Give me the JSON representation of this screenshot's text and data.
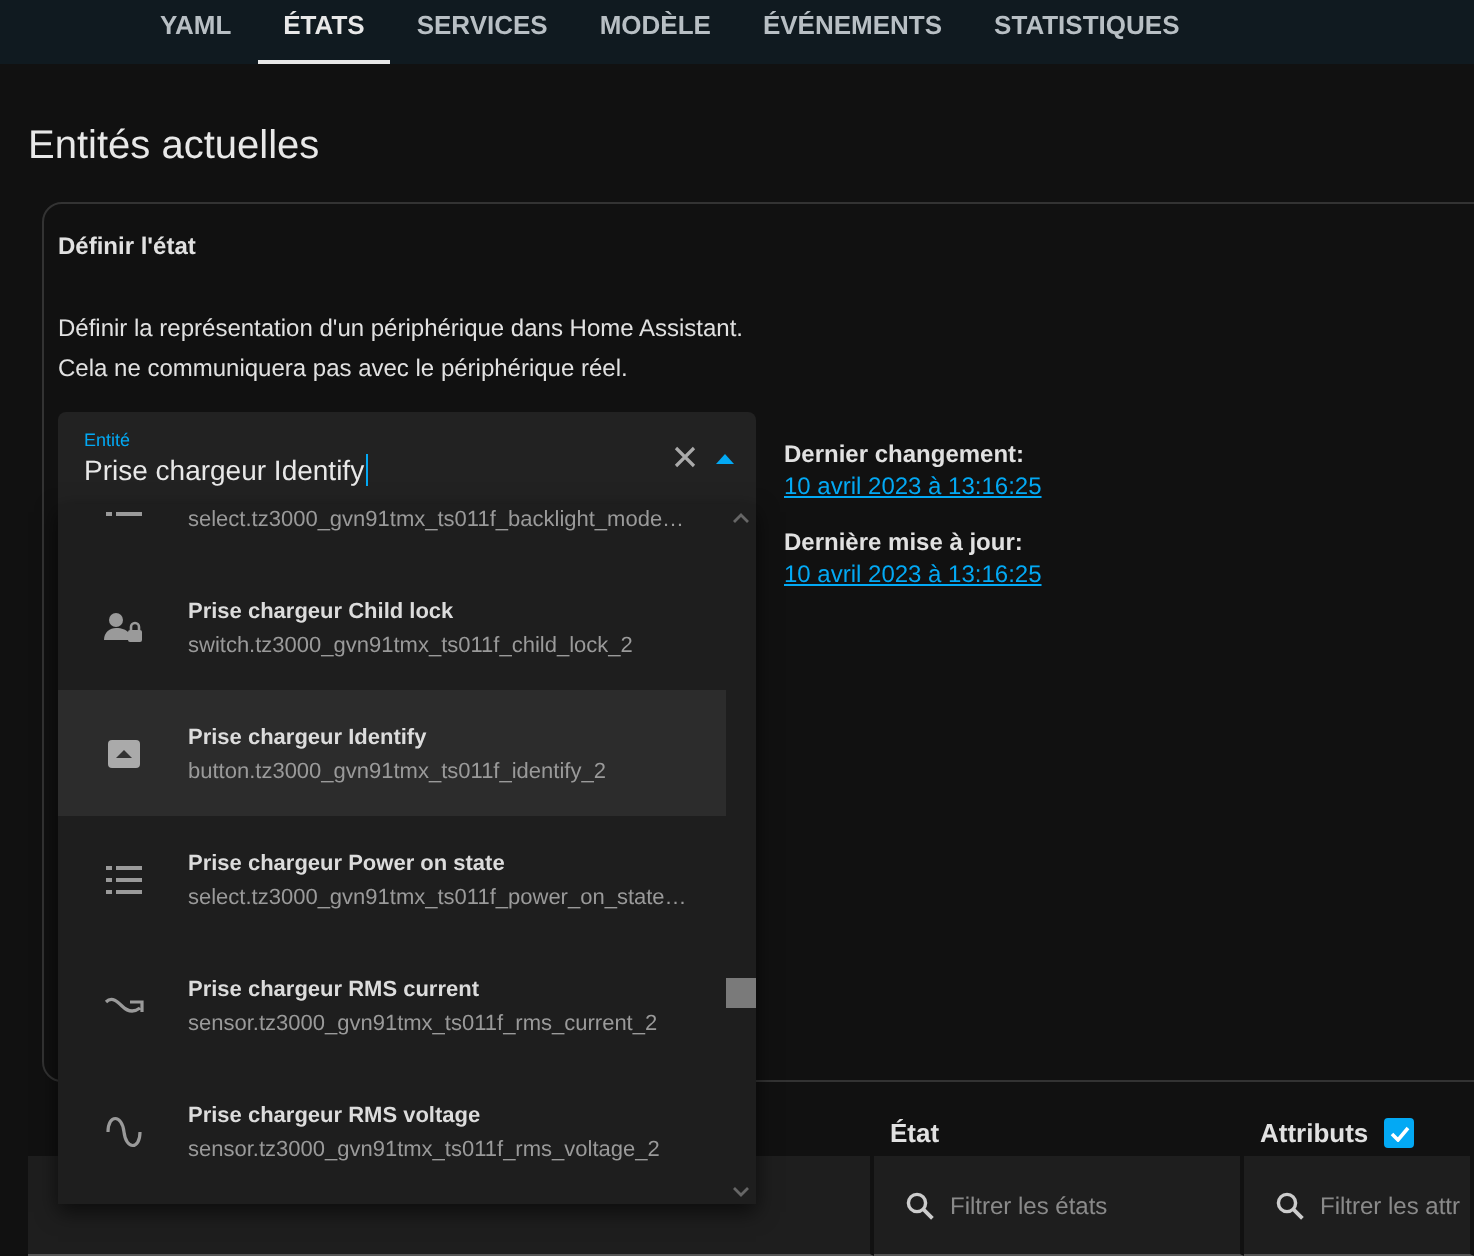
{
  "tabs": [
    {
      "label": "YAML",
      "selected": false
    },
    {
      "label": "ÉTATS",
      "selected": true
    },
    {
      "label": "SERVICES",
      "selected": false
    },
    {
      "label": "MODÈLE",
      "selected": false
    },
    {
      "label": "ÉVÉNEMENTS",
      "selected": false
    },
    {
      "label": "STATISTIQUES",
      "selected": false
    }
  ],
  "heading": "Entités actuelles",
  "set_state": {
    "title": "Définir l'état",
    "description": [
      "Définir la représentation d'un périphérique dans Home Assistant.",
      "Cela ne communiquera pas avec le périphérique réel."
    ],
    "entity_field": {
      "label": "Entité",
      "value": "Prise chargeur Identify"
    },
    "info": [
      {
        "label": "Dernier changement:",
        "value": "10 avril 2023 à 13:16:25"
      },
      {
        "label": "Dernière mise à jour:",
        "value": "10 avril 2023 à 13:16:25"
      }
    ]
  },
  "dropdown": {
    "items": [
      {
        "kind": "list",
        "id": "select.tz3000_gvn91tmx_ts011f_backlight_mode…",
        "selected": false
      },
      {
        "kind": "lock",
        "title": "Prise chargeur Child lock",
        "id": "switch.tz3000_gvn91tmx_ts011f_child_lock_2",
        "selected": false
      },
      {
        "kind": "button",
        "title": "Prise chargeur Identify",
        "id": "button.tz3000_gvn91tmx_ts011f_identify_2",
        "selected": true
      },
      {
        "kind": "list",
        "title": "Prise chargeur Power on state",
        "id": "select.tz3000_gvn91tmx_ts011f_power_on_state…",
        "selected": false
      },
      {
        "kind": "current",
        "title": "Prise chargeur RMS current",
        "id": "sensor.tz3000_gvn91tmx_ts011f_rms_current_2",
        "selected": false
      },
      {
        "kind": "wave",
        "title": "Prise chargeur RMS voltage",
        "id": "sensor.tz3000_gvn91tmx_ts011f_rms_voltage_2",
        "selected": false
      }
    ]
  },
  "table": {
    "columns": [
      {
        "label": "État"
      },
      {
        "label": "Attributs",
        "checked": true
      }
    ],
    "filters": [
      {
        "placeholder": "Filtrer les états"
      },
      {
        "placeholder": "Filtrer les attr"
      }
    ]
  }
}
